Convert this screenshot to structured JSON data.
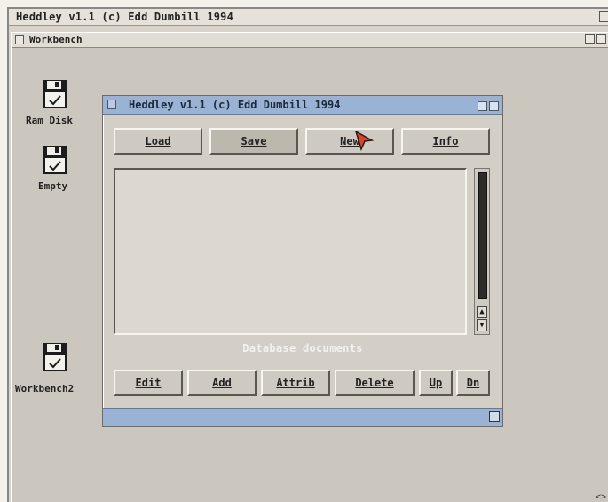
{
  "screen": {
    "title": "Heddley v1.1 (c) Edd Dumbill 1994"
  },
  "workbench": {
    "title": "Workbench"
  },
  "desktop_icons": [
    {
      "label": "Ram Disk",
      "icon": "floppy-disk-icon"
    },
    {
      "label": "Empty",
      "icon": "floppy-disk-icon"
    },
    {
      "label": "Workbench2",
      "icon": "floppy-disk-icon"
    }
  ],
  "heddley": {
    "title": "Heddley v1.1 (c) Edd Dumbill 1994",
    "buttons_top": [
      "Load",
      "Save",
      "New",
      "Info"
    ],
    "list_caption": "Database documents",
    "buttons_bottom": [
      "Edit",
      "Add",
      "Attrib",
      "Delete",
      "Up",
      "Dn"
    ]
  },
  "colors": {
    "window_titlebar": "#9ab3d4",
    "window_bg": "#d4cfc6",
    "desktop_bg": "#ccc7be"
  }
}
